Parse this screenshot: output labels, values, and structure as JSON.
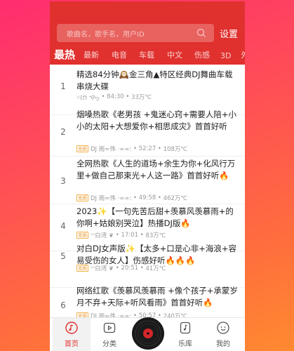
{
  "header": {
    "search_placeholder": "歌曲名，歌手名，用户ID",
    "settings_label": "设置"
  },
  "tabs": [
    "最热",
    "最新",
    "电音",
    "车载",
    "中文",
    "伤感",
    "3D",
    "外"
  ],
  "songs": [
    {
      "num": "1",
      "title": "精选84分钟🕰️金三角▲特区经典DJ舞曲车载串烧大碟",
      "tag": "",
      "singer": "ᛜ(ᱬ️ ᐩᠪᠭ",
      "duration": "84:30",
      "plays": "33万℃"
    },
    {
      "num": "2",
      "title": "烟嗓热歌《老男孩 +鬼迷心窍+需要人陪+小小的太阳+大想爱你+相思成灾》首首好听",
      "tag": "无损",
      "singer": "DJ 雨≈伟 ·∞∞:",
      "duration": "52:27",
      "plays": "108万℃"
    },
    {
      "num": "3",
      "title": "全网热歌《人生的道场+余生为你+化风行万里+做自己那束光+人这一路》首首好听🔥",
      "tag": "无损",
      "singer": "DJ 雨≈伟 ·∞∞:",
      "duration": "49:58",
      "plays": "462万℃"
    },
    {
      "num": "4",
      "title": "2023✨【一句先苦后甜+羡慕风羡慕雨+的你啊+姑娘别哭泣】热播DJ版🔥",
      "tag": "无损",
      "singer": "ᵓᵓ白湾 ❦",
      "duration": "17:01",
      "plays": "83万℃"
    },
    {
      "num": "5",
      "title": "对白DJ女声版✨【太多+口是心非+海浪+容易受伤的女人】伤感好听🔥🔥🔥",
      "tag": "无损",
      "singer": "ᵓᵓ白湾 ❦",
      "duration": "20:51",
      "plays": "41万℃"
    },
    {
      "num": "6",
      "title": "网络红歌《羡慕风羡慕雨 +像个孩子+承蒙岁月不弃+天际+听风看雨》首首好听🔥",
      "tag": "无损",
      "singer": "DJ 雨≈伟 ·∞∞:",
      "duration": "50:57",
      "plays": "240万℃"
    }
  ],
  "bottom_nav": [
    {
      "label": "首页",
      "icon": "music-note-icon"
    },
    {
      "label": "分类",
      "icon": "video-icon"
    },
    {
      "label": "",
      "icon": "vinyl-disc-icon"
    },
    {
      "label": "乐库",
      "icon": "music-library-icon"
    },
    {
      "label": "我的",
      "icon": "user-icon"
    }
  ],
  "colors": {
    "accent": "#e0312e",
    "background_gradient_start": "#ff2d6f",
    "background_gradient_end": "#ff8a30",
    "tag_color": "#e88e1a"
  }
}
